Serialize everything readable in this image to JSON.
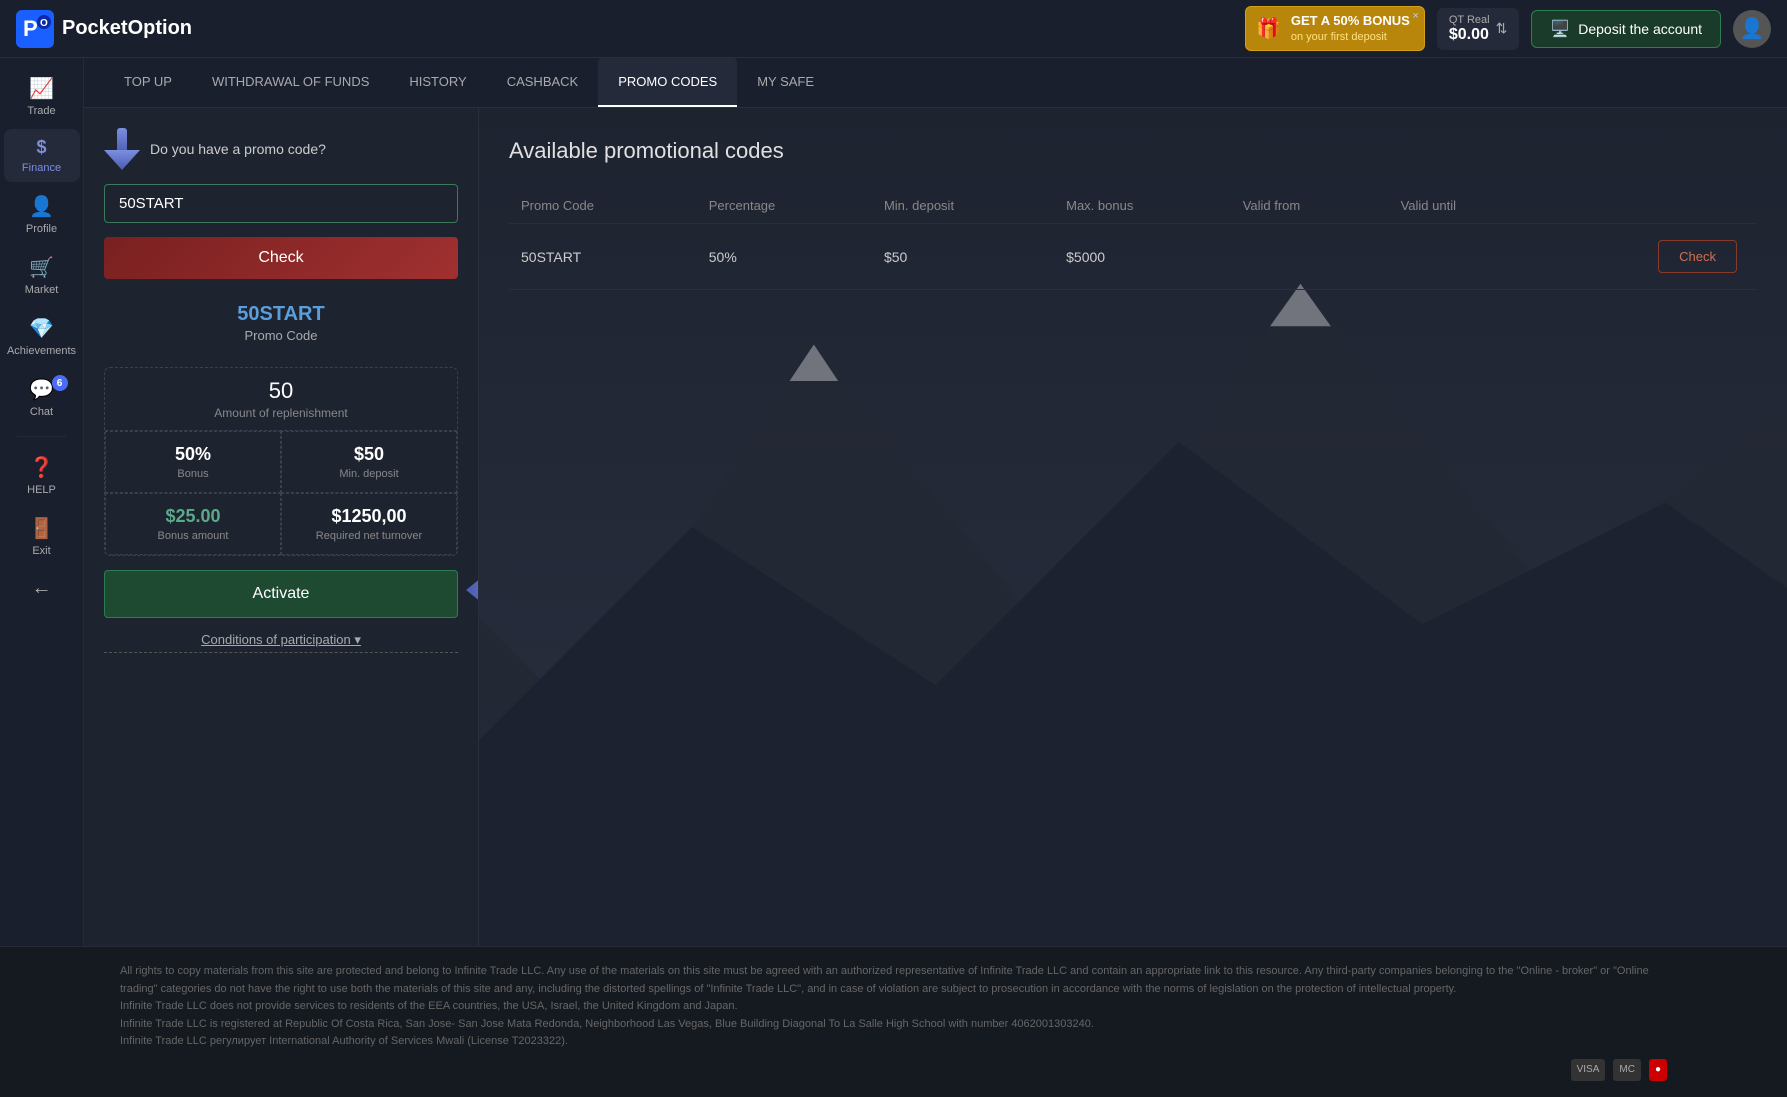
{
  "header": {
    "logo_text": "PocketOption",
    "bonus": {
      "line1": "GET A 50% BONUS",
      "line2": "on your first deposit",
      "close": "×"
    },
    "balance": {
      "label": "QT Real",
      "value": "$0.00",
      "arrows": "⇅"
    },
    "deposit_btn": "Deposit the account",
    "avatar_icon": "👤"
  },
  "sidebar": {
    "items": [
      {
        "id": "trade",
        "icon": "📈",
        "label": "Trade"
      },
      {
        "id": "finance",
        "icon": "$",
        "label": "Finance",
        "active": true
      },
      {
        "id": "profile",
        "icon": "👤",
        "label": "Profile"
      },
      {
        "id": "market",
        "icon": "🛒",
        "label": "Market"
      },
      {
        "id": "achievements",
        "icon": "💎",
        "label": "Achievements"
      },
      {
        "id": "chat",
        "icon": "💬",
        "label": "Chat",
        "badge": "6"
      },
      {
        "id": "help",
        "icon": "❓",
        "label": "HELP"
      },
      {
        "id": "exit",
        "icon": "🚪",
        "label": "Exit"
      },
      {
        "id": "back",
        "icon": "←",
        "label": ""
      }
    ]
  },
  "tabs": [
    {
      "id": "top-up",
      "label": "TOP UP"
    },
    {
      "id": "withdrawal",
      "label": "WITHDRAWAL OF FUNDS"
    },
    {
      "id": "history",
      "label": "HISTORY"
    },
    {
      "id": "cashback",
      "label": "CASHBACK"
    },
    {
      "id": "promo-codes",
      "label": "PROMO CODES",
      "active": true
    },
    {
      "id": "my-safe",
      "label": "MY SAFE"
    }
  ],
  "left_panel": {
    "promo_question": "Do you have a promo code?",
    "promo_input_value": "50START",
    "check_button": "Check",
    "result": {
      "code_name": "50START",
      "code_label": "Promo Code"
    },
    "stats": {
      "replenish_value": "50",
      "replenish_label": "Amount of replenishment",
      "bonus_value": "50%",
      "bonus_label": "Bonus",
      "min_deposit_value": "$50",
      "min_deposit_label": "Min. deposit",
      "bonus_amount_value": "$25.00",
      "bonus_amount_label": "Bonus amount",
      "required_turnover_value": "$1250,00",
      "required_turnover_label": "Required net turnover"
    },
    "activate_button": "Activate",
    "conditions_link": "Conditions of participation"
  },
  "right_panel": {
    "title": "Available promotional codes",
    "table": {
      "columns": [
        "Promo Code",
        "Percentage",
        "Min. deposit",
        "Max. bonus",
        "Valid from",
        "Valid until",
        ""
      ],
      "rows": [
        {
          "promo_code": "50START",
          "percentage": "50%",
          "min_deposit": "$50",
          "max_bonus": "$5000",
          "valid_from": "",
          "valid_until": "",
          "action": "Check"
        }
      ]
    }
  },
  "footer": {
    "text1": "All rights to copy materials from this site are protected and belong to Infinite Trade LLC. Any use of the materials on this site must be agreed with an authorized representative of Infinite Trade LLC and contain an appropriate link to this resource. Any third-party companies belonging to the \"Online - broker\" or \"Online trading\" categories do not have the right to use both the materials of this site and any, including the distorted spellings of \"Infinite Trade LLC\", and in case of violation are subject to prosecution in accordance with the norms of legislation on the protection of intellectual property.",
    "text2": "Infinite Trade LLC does not provide services to residents of the EEA countries, the USA, Israel, the United Kingdom and Japan.",
    "text3": "Infinite Trade LLC is registered at Republic Of Costa Rica, San Jose- San Jose Mata Redonda, Neighborhood Las Vegas, Blue Building Diagonal To La Salle High School with number 4062001303240.",
    "text4": "Infinite Trade LLC регулирует International Authority of Services Mwali (License T2023322).",
    "payment_icons": [
      "VISA",
      "MC",
      "🔴"
    ]
  }
}
